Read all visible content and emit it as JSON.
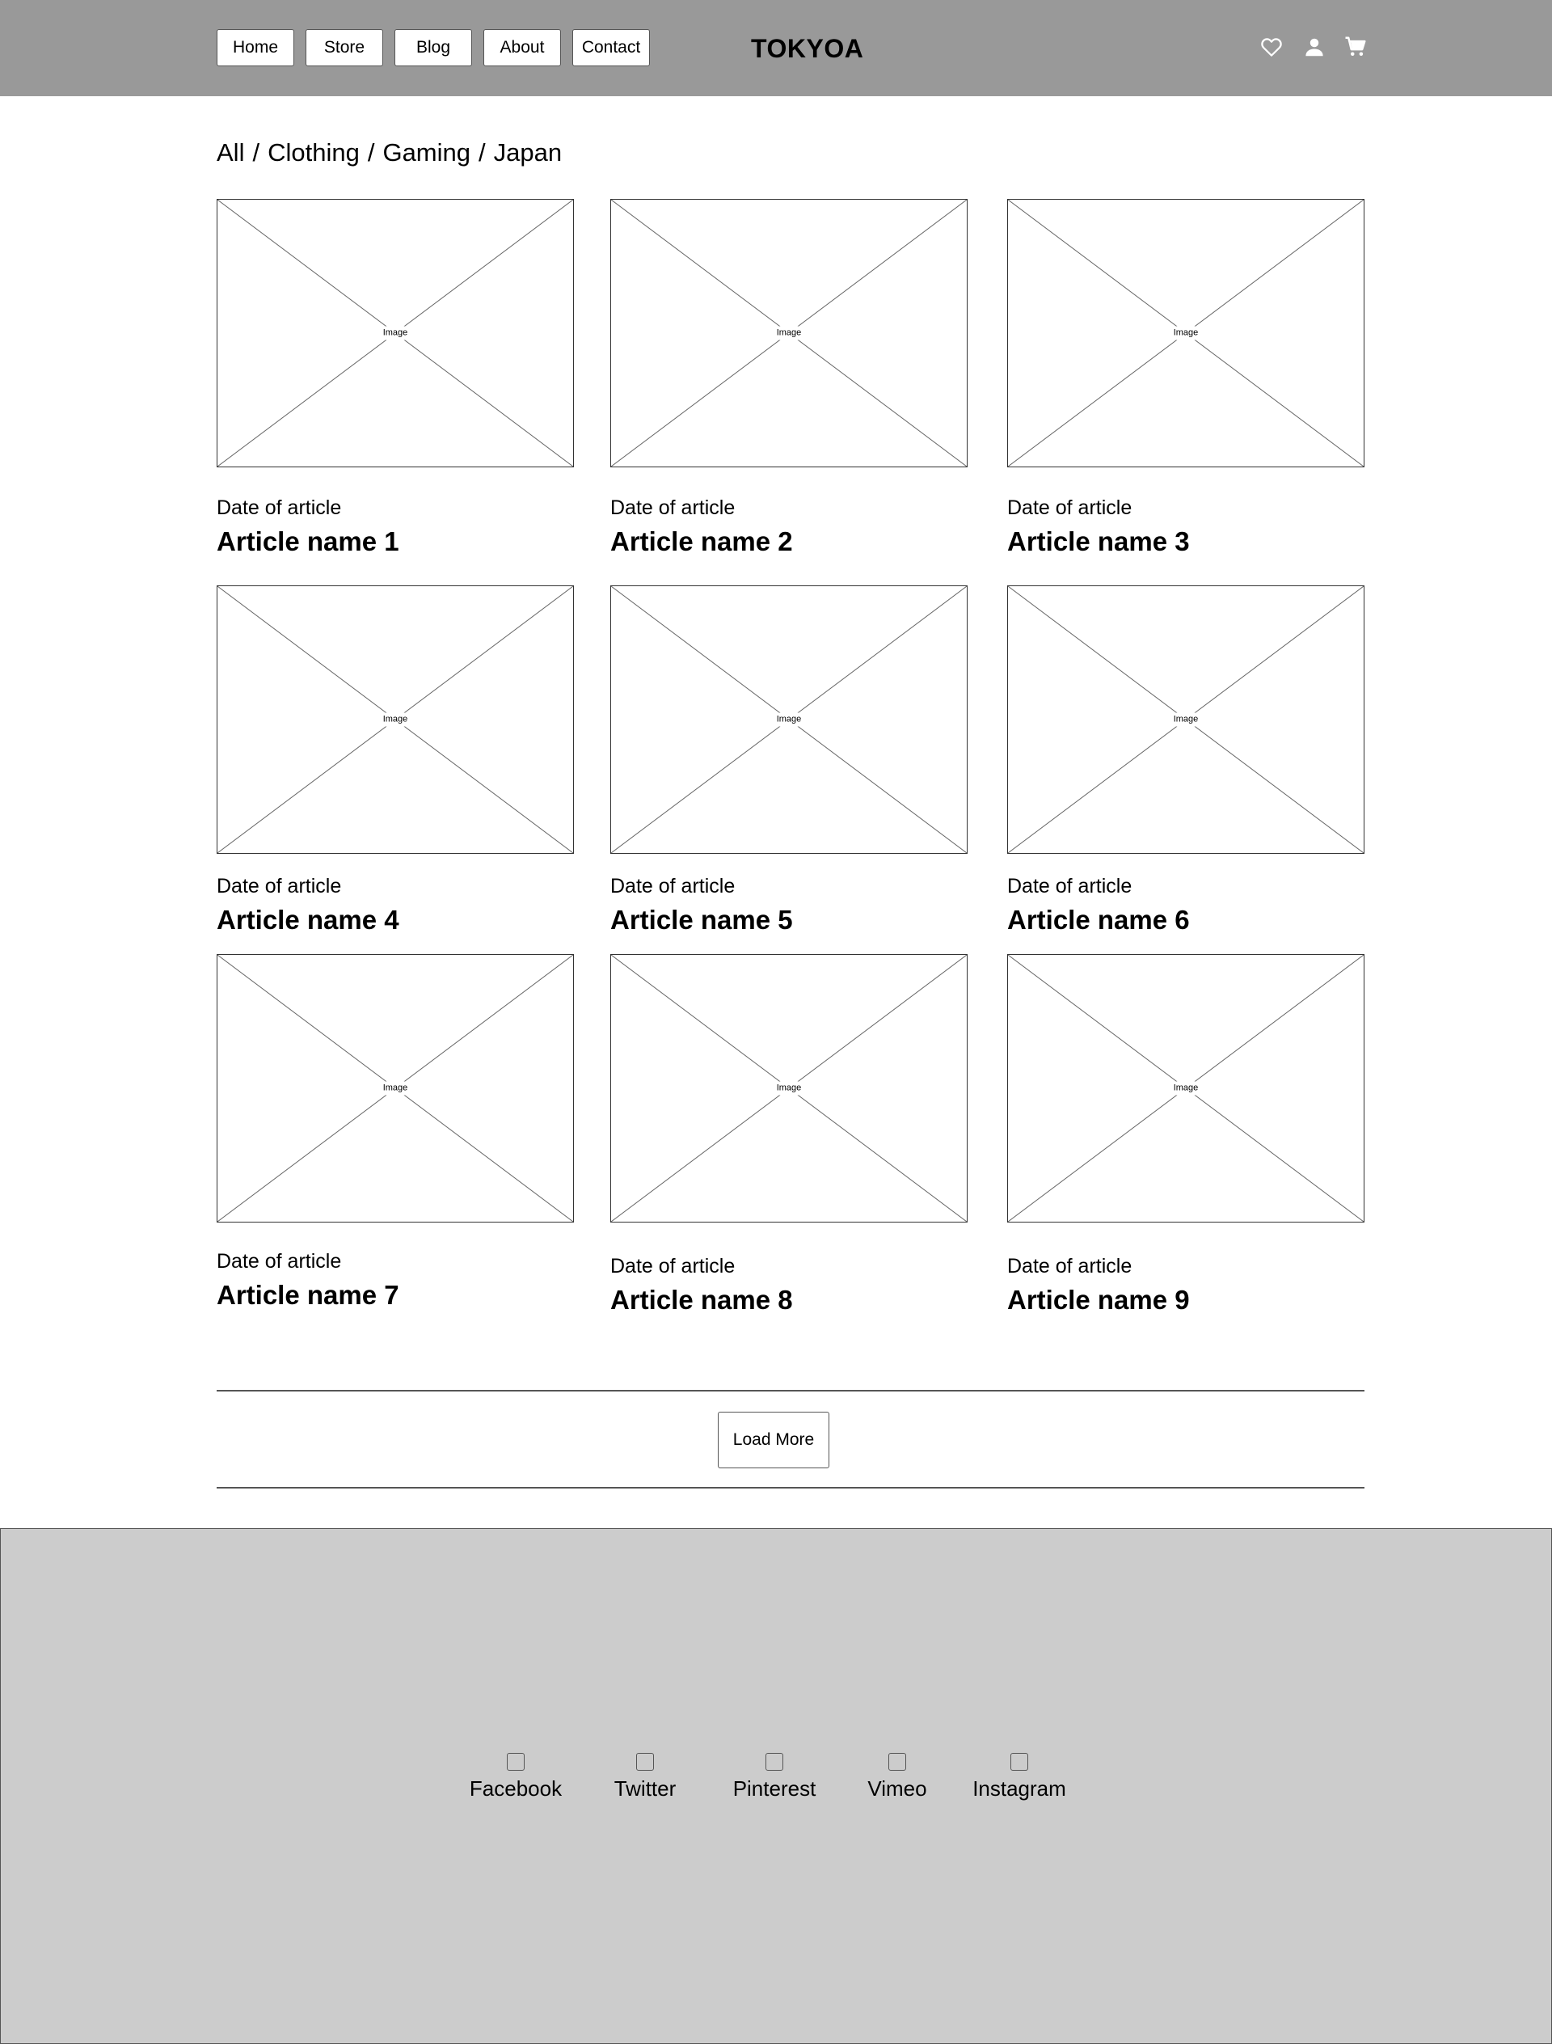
{
  "header": {
    "nav": [
      "Home",
      "Store",
      "Blog",
      "About",
      "Contact"
    ],
    "logo": "TOKYOA",
    "icons": [
      "heart-icon",
      "user-icon",
      "cart-icon"
    ]
  },
  "breadcrumb": [
    "All",
    "Clothing",
    "Gaming",
    "Japan"
  ],
  "breadcrumb_separator": "/",
  "articles": [
    {
      "image_label": "Image",
      "date": "Date of article",
      "title": "Article name 1"
    },
    {
      "image_label": "Image",
      "date": "Date of article",
      "title": "Article name 2"
    },
    {
      "image_label": "Image",
      "date": "Date of article",
      "title": "Article name 3"
    },
    {
      "image_label": "Image",
      "date": "Date of article",
      "title": "Article name 4"
    },
    {
      "image_label": "Image",
      "date": "Date of article",
      "title": "Article name 5"
    },
    {
      "image_label": "Image",
      "date": "Date of article",
      "title": "Article name 6"
    },
    {
      "image_label": "Image",
      "date": "Date of article",
      "title": "Article name 7"
    },
    {
      "image_label": "Image",
      "date": "Date of article",
      "title": "Article name 8"
    },
    {
      "image_label": "Image",
      "date": "Date of article",
      "title": "Article name 9"
    }
  ],
  "load_more_label": "Load More",
  "footer": {
    "social": [
      "Facebook",
      "Twitter",
      "Pinterest",
      "Vimeo",
      "Instagram"
    ]
  },
  "colors": {
    "header_bg": "#999999",
    "footer_bg": "#cccccc",
    "page_bg": "#ffffff"
  }
}
